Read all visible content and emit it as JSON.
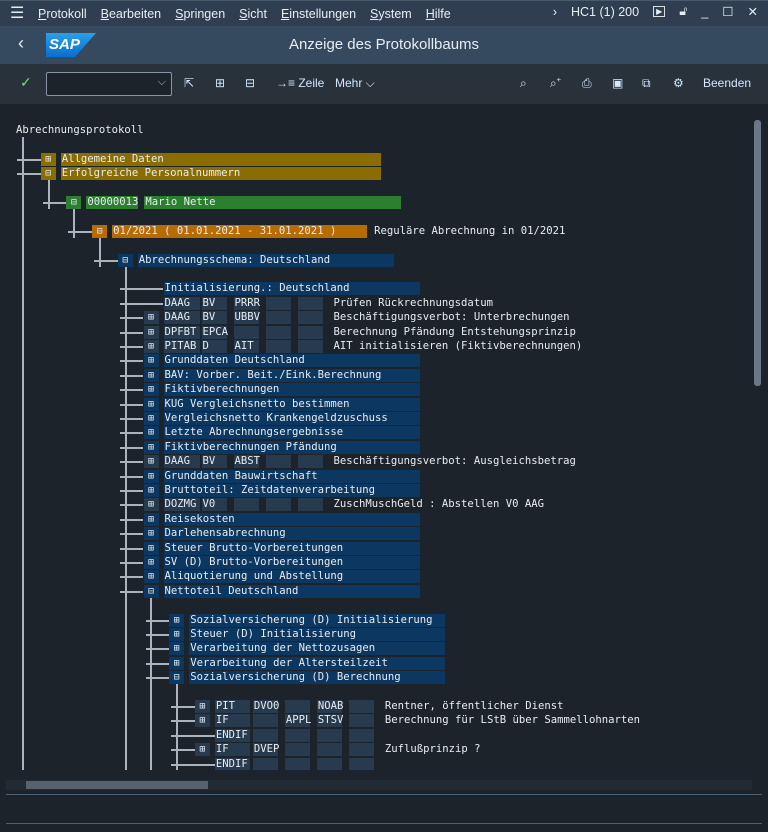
{
  "menubar": {
    "items": [
      "Protokoll",
      "Bearbeiten",
      "Springen",
      "Sicht",
      "Einstellungen",
      "System",
      "Hilfe"
    ],
    "system_info": "HC1 (1) 200"
  },
  "titlebar": {
    "title": "Anzeige des Protokollbaums",
    "logo": "SAP"
  },
  "toolbar": {
    "zeile": "Zeile",
    "mehr": "Mehr",
    "beenden": "Beenden",
    "command_value": ""
  },
  "colors": {
    "gold": "#8a6d00",
    "green": "#2b7f2e",
    "orange": "#b86b00",
    "blue": "#0b3760"
  },
  "tree": {
    "rows": [
      {
        "i": 0,
        "lvl": 0,
        "icon": "none",
        "text": "Abrechnungsprotokoll",
        "color": ""
      },
      {
        "i": 2,
        "lvl": 1,
        "icon": "plus",
        "text": "Allgemeine Daten",
        "color": "gold"
      },
      {
        "i": 3,
        "lvl": 1,
        "icon": "minus",
        "text": "Erfolgreiche Personalnummern",
        "color": "gold"
      },
      {
        "i": 5,
        "lvl": 2,
        "icon": "minus",
        "text": "00000013",
        "text2": "Mario Nette",
        "color": "green"
      },
      {
        "i": 7,
        "lvl": 3,
        "icon": "minus",
        "text": "01/2021 ( 01.01.2021 - 31.01.2021 )",
        "desc": "Reguläre Abrechnung in 01/2021",
        "color": "orange"
      },
      {
        "i": 9,
        "lvl": 4,
        "icon": "minus",
        "text": "Abrechnungsschema: Deutschland",
        "color": "blue"
      },
      {
        "i": 11,
        "lvl": 5,
        "icon": "none",
        "text": "Initialisierung.: Deutschland",
        "color": "blue"
      },
      {
        "i": 12,
        "lvl": 5,
        "icon": "none",
        "cells": [
          "DAAG",
          "BV",
          "PRRR",
          "",
          ""
        ],
        "desc": "Prüfen Rückrechnungsdatum"
      },
      {
        "i": 13,
        "lvl": 5,
        "icon": "plus",
        "cells": [
          "DAAG",
          "BV",
          "UBBV",
          "",
          ""
        ],
        "desc": "Beschäftigungsverbot: Unterbrechungen"
      },
      {
        "i": 14,
        "lvl": 5,
        "icon": "plus",
        "cells": [
          "DPFBT",
          "EPCA",
          "",
          "",
          ""
        ],
        "desc": "Berechnung Pfändung Entstehungsprinzip"
      },
      {
        "i": 15,
        "lvl": 5,
        "icon": "plus",
        "cells": [
          "PITAB",
          "D",
          "AIT",
          "",
          ""
        ],
        "desc": "AIT initialisieren (Fiktivberechnungen)"
      },
      {
        "i": 16,
        "lvl": 5,
        "icon": "plus",
        "text": "Grunddaten Deutschland",
        "color": "blue"
      },
      {
        "i": 17,
        "lvl": 5,
        "icon": "plus",
        "text": "BAV: Vorber. Beit./Eink.Berechnung",
        "color": "blue"
      },
      {
        "i": 18,
        "lvl": 5,
        "icon": "plus",
        "text": "Fiktivberechnungen",
        "color": "blue"
      },
      {
        "i": 19,
        "lvl": 5,
        "icon": "plus",
        "text": "KUG Vergleichsnetto bestimmen",
        "color": "blue"
      },
      {
        "i": 20,
        "lvl": 5,
        "icon": "plus",
        "text": "Vergleichsnetto Krankengeldzuschuss",
        "color": "blue"
      },
      {
        "i": 21,
        "lvl": 5,
        "icon": "plus",
        "text": "Letzte Abrechnungsergebnisse",
        "color": "blue"
      },
      {
        "i": 22,
        "lvl": 5,
        "icon": "plus",
        "text": "Fiktivberechnungen Pfändung",
        "color": "blue"
      },
      {
        "i": 23,
        "lvl": 5,
        "icon": "plus",
        "cells": [
          "DAAG",
          "BV",
          "ABST",
          "",
          ""
        ],
        "desc": "Beschäftigungsverbot: Ausgleichsbetrag"
      },
      {
        "i": 24,
        "lvl": 5,
        "icon": "plus",
        "text": "Grunddaten Bauwirtschaft",
        "color": "blue"
      },
      {
        "i": 25,
        "lvl": 5,
        "icon": "plus",
        "text": "Bruttoteil: Zeitdatenverarbeitung",
        "color": "blue"
      },
      {
        "i": 26,
        "lvl": 5,
        "icon": "plus",
        "cells": [
          "DOZMG",
          "V0",
          "",
          "",
          ""
        ],
        "desc": "ZuschMuschGeld : Abstellen V0 AAG"
      },
      {
        "i": 27,
        "lvl": 5,
        "icon": "plus",
        "text": "Reisekosten",
        "color": "blue"
      },
      {
        "i": 28,
        "lvl": 5,
        "icon": "plus",
        "text": "Darlehensabrechnung",
        "color": "blue"
      },
      {
        "i": 29,
        "lvl": 5,
        "icon": "plus",
        "text": "Steuer Brutto-Vorbereitungen",
        "color": "blue"
      },
      {
        "i": 30,
        "lvl": 5,
        "icon": "plus",
        "text": "SV (D) Brutto-Vorbereitungen",
        "color": "blue"
      },
      {
        "i": 31,
        "lvl": 5,
        "icon": "plus",
        "text": "Aliquotierung und Abstellung",
        "color": "blue"
      },
      {
        "i": 32,
        "lvl": 5,
        "icon": "minus",
        "text": "Nettoteil Deutschland",
        "color": "blue"
      },
      {
        "i": 34,
        "lvl": 6,
        "icon": "plus",
        "text": "Sozialversicherung (D) Initialisierung",
        "color": "blue"
      },
      {
        "i": 35,
        "lvl": 6,
        "icon": "plus",
        "text": "Steuer (D) Initialisierung",
        "color": "blue"
      },
      {
        "i": 36,
        "lvl": 6,
        "icon": "plus",
        "text": "Verarbeitung der Nettozusagen",
        "color": "blue"
      },
      {
        "i": 37,
        "lvl": 6,
        "icon": "plus",
        "text": "Verarbeitung der Altersteilzeit",
        "color": "blue"
      },
      {
        "i": 38,
        "lvl": 6,
        "icon": "minus",
        "text": "Sozialversicherung (D) Berechnung",
        "color": "blue"
      },
      {
        "i": 40,
        "lvl": 7,
        "icon": "plus",
        "cells": [
          "PIT",
          "DVO0",
          "",
          "NOAB",
          ""
        ],
        "desc": "Rentner, öffentlicher Dienst"
      },
      {
        "i": 41,
        "lvl": 7,
        "icon": "plus",
        "cells": [
          "IF",
          "",
          "APPL",
          "STSV",
          ""
        ],
        "desc": "Berechnung für LStB über Sammellohnarten"
      },
      {
        "i": 42,
        "lvl": 7,
        "icon": "none",
        "cells": [
          "ENDIF",
          "",
          "",
          "",
          ""
        ],
        "desc": ""
      },
      {
        "i": 43,
        "lvl": 7,
        "icon": "plus",
        "cells": [
          "IF",
          "DVEP",
          "",
          "",
          ""
        ],
        "desc": "Zuflußprinzip ?"
      },
      {
        "i": 44,
        "lvl": 7,
        "icon": "none",
        "cells": [
          "ENDIF",
          "",
          "",
          "",
          ""
        ],
        "desc": ""
      }
    ]
  }
}
